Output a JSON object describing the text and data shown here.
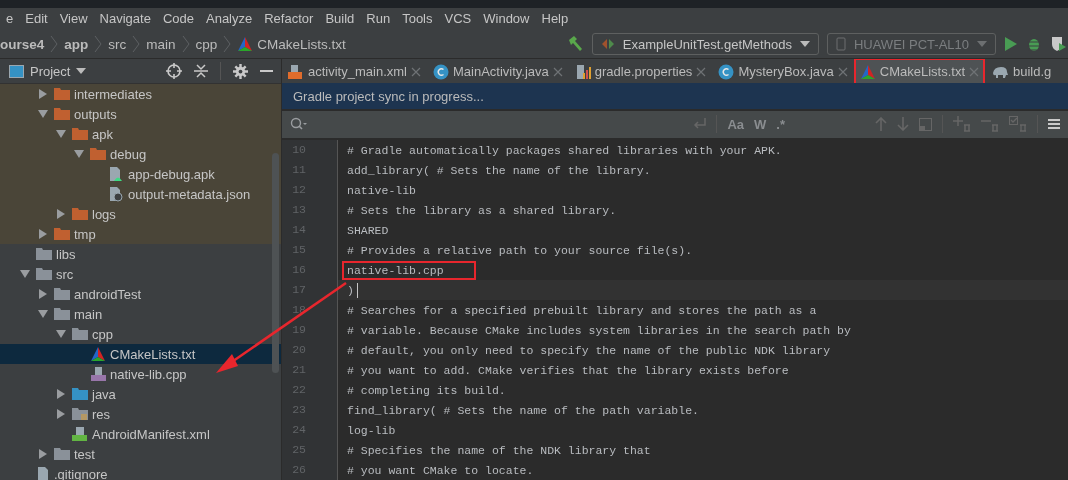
{
  "menu": [
    "e",
    "Edit",
    "View",
    "Navigate",
    "Code",
    "Analyze",
    "Refactor",
    "Build",
    "Run",
    "Tools",
    "VCS",
    "Window",
    "Help"
  ],
  "breadcrumb": [
    {
      "label": "ourse4",
      "bold": true,
      "kind": "text"
    },
    {
      "label": "app",
      "bold": true,
      "kind": "text"
    },
    {
      "label": "src",
      "bold": false,
      "kind": "text"
    },
    {
      "label": "main",
      "bold": false,
      "kind": "text"
    },
    {
      "label": "cpp",
      "bold": false,
      "kind": "text"
    },
    {
      "label": "CMakeLists.txt",
      "bold": false,
      "kind": "cmake"
    }
  ],
  "run_config": {
    "label": "ExampleUnitTest.getMethods",
    "disabled": false
  },
  "device": {
    "label": "HUAWEI PCT-AL10",
    "disabled": true
  },
  "project_panel": {
    "title": "Project"
  },
  "tree": {
    "continued_children": [
      {
        "label": "intermediates",
        "kind": "folder",
        "expanded": false,
        "excluded": true,
        "selected": false
      },
      {
        "label": "outputs",
        "kind": "folder",
        "expanded": true,
        "excluded": true,
        "selected": false,
        "children": [
          {
            "label": "apk",
            "kind": "folder",
            "expanded": true,
            "excluded": true,
            "selected": false,
            "children": [
              {
                "label": "debug",
                "kind": "folder",
                "expanded": true,
                "excluded": true,
                "selected": false,
                "children": [
                  {
                    "label": "app-debug.apk",
                    "kind": "apk",
                    "excluded": true,
                    "selected": false
                  },
                  {
                    "label": "output-metadata.json",
                    "kind": "json",
                    "excluded": true,
                    "selected": false
                  }
                ]
              }
            ]
          },
          {
            "label": "logs",
            "kind": "folder",
            "expanded": false,
            "excluded": true,
            "selected": false
          }
        ]
      },
      {
        "label": "tmp",
        "kind": "folder",
        "expanded": false,
        "excluded": true,
        "selected": false
      }
    ],
    "items": [
      {
        "label": "libs",
        "kind": "folder",
        "excluded": false,
        "selected": false
      },
      {
        "label": "src",
        "kind": "folder",
        "expanded": true,
        "excluded": false,
        "selected": false,
        "children": [
          {
            "label": "androidTest",
            "kind": "folder",
            "expanded": false,
            "excluded": false,
            "selected": false
          },
          {
            "label": "main",
            "kind": "folder",
            "expanded": true,
            "excluded": false,
            "selected": false,
            "children": [
              {
                "label": "cpp",
                "kind": "folder",
                "expanded": true,
                "excluded": false,
                "selected": false,
                "children": [
                  {
                    "label": "CMakeLists.txt",
                    "kind": "cmake",
                    "excluded": false,
                    "selected": true
                  },
                  {
                    "label": "native-lib.cpp",
                    "kind": "cpp",
                    "excluded": false,
                    "selected": false
                  }
                ]
              },
              {
                "label": "java",
                "kind": "java",
                "expanded": false,
                "excluded": false,
                "selected": false
              },
              {
                "label": "res",
                "kind": "res",
                "expanded": false,
                "excluded": false,
                "selected": false
              },
              {
                "label": "AndroidManifest.xml",
                "kind": "manifest",
                "excluded": false,
                "selected": false
              }
            ]
          },
          {
            "label": "test",
            "kind": "folder",
            "expanded": false,
            "excluded": false,
            "selected": false
          }
        ]
      },
      {
        "label": ".gitignore",
        "kind": "file",
        "excluded": false,
        "selected": false
      }
    ]
  },
  "tabs": [
    {
      "label": "activity_main.xml",
      "kind": "xml",
      "selected": false,
      "highlighted": false,
      "closable": true
    },
    {
      "label": "MainActivity.java",
      "kind": "class",
      "selected": false,
      "highlighted": false,
      "closable": true
    },
    {
      "label": "gradle.properties",
      "kind": "properties",
      "selected": false,
      "highlighted": false,
      "closable": true
    },
    {
      "label": "MysteryBox.java",
      "kind": "class",
      "selected": false,
      "highlighted": false,
      "closable": true
    },
    {
      "label": "CMakeLists.txt",
      "kind": "cmake",
      "selected": true,
      "highlighted": true,
      "closable": true
    },
    {
      "label": "build.g",
      "kind": "gradle",
      "selected": false,
      "highlighted": false,
      "closable": false
    }
  ],
  "banner": "Gradle project sync in progress...",
  "find_toggles": [
    "Aa",
    "W",
    ".*"
  ],
  "code_lines": [
    {
      "number": "10",
      "text": "# Gradle automatically packages shared libraries with your APK.",
      "current": false,
      "highlighted": false
    },
    {
      "number": "11",
      "text": "add_library( # Sets the name of the library.",
      "current": false,
      "highlighted": false
    },
    {
      "number": "12",
      "text": "native-lib",
      "current": false,
      "highlighted": false
    },
    {
      "number": "13",
      "text": "# Sets the library as a shared library.",
      "current": false,
      "highlighted": false
    },
    {
      "number": "14",
      "text": "SHARED",
      "current": false,
      "highlighted": false
    },
    {
      "number": "15",
      "text": "# Provides a relative path to your source file(s).",
      "current": false,
      "highlighted": false
    },
    {
      "number": "16",
      "text": "native-lib.cpp",
      "current": false,
      "highlighted": true
    },
    {
      "number": "17",
      "text": ")",
      "current": true,
      "highlighted": false
    },
    {
      "number": "18",
      "text": "# Searches for a specified prebuilt library and stores the path as a",
      "current": false,
      "highlighted": false
    },
    {
      "number": "19",
      "text": "# variable. Because CMake includes system libraries in the search path by",
      "current": false,
      "highlighted": false
    },
    {
      "number": "20",
      "text": "# default, you only need to specify the name of the public NDK library",
      "current": false,
      "highlighted": false
    },
    {
      "number": "21",
      "text": "# you want to add. CMake verifies that the library exists before",
      "current": false,
      "highlighted": false
    },
    {
      "number": "22",
      "text": "# completing its build.",
      "current": false,
      "highlighted": false
    },
    {
      "number": "23",
      "text": "find_library( # Sets the name of the path variable.",
      "current": false,
      "highlighted": false
    },
    {
      "number": "24",
      "text": "log-lib",
      "current": false,
      "highlighted": false
    },
    {
      "number": "25",
      "text": "# Specifies the name of the NDK library that",
      "current": false,
      "highlighted": false
    },
    {
      "number": "26",
      "text": "# you want CMake to locate.",
      "current": false,
      "highlighted": false
    }
  ],
  "annotation_arrow": true
}
